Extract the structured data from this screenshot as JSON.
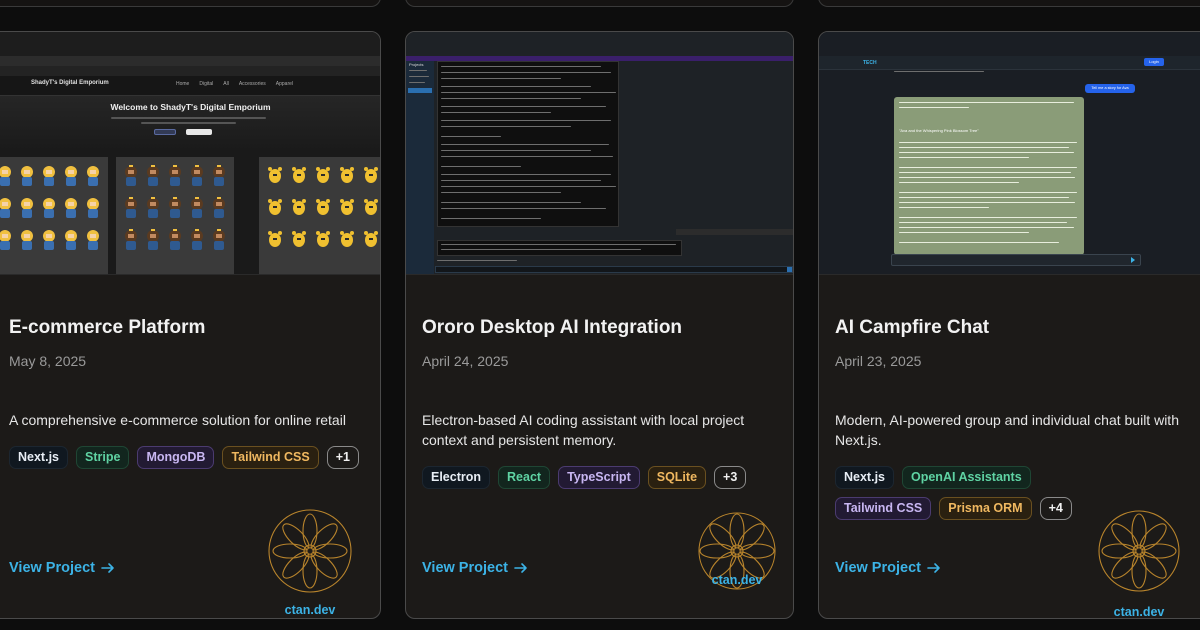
{
  "watermark": {
    "text": "ctan.dev"
  },
  "cards": [
    {
      "title": "E-commerce Platform",
      "date": "May 8, 2025",
      "description": "A comprehensive e-commerce solution for online retail",
      "tags": [
        "Next.js",
        "Stripe",
        "MongoDB",
        "Tailwind CSS"
      ],
      "more": "+1",
      "link": "View Project",
      "screenshot": {
        "brand": "ShadyT's Digital Emporium",
        "heading": "Welcome to ShadyT's Digital Emporium",
        "nav": [
          "Home",
          "Digital",
          "All",
          "Accessories",
          "Apparel"
        ]
      }
    },
    {
      "title": "Ororo Desktop AI Integration",
      "date": "April 24, 2025",
      "description": "Electron-based AI coding assistant with local project context and persistent memory.",
      "tags": [
        "Electron",
        "React",
        "TypeScript",
        "SQLite"
      ],
      "more": "+3",
      "link": "View Project",
      "screenshot": {
        "sidebar_title": "Projects"
      }
    },
    {
      "title": "AI Campfire Chat",
      "date": "April 23, 2025",
      "description": "Modern, AI-powered group and individual chat built with Next.js.",
      "tags": [
        "Next.js",
        "OpenAI Assistants",
        "Tailwind CSS",
        "Prisma ORM"
      ],
      "more": "+4",
      "link": "View Project",
      "screenshot": {
        "brand": "TECH",
        "login": "Login",
        "prompt": "Tell me a story for Ava",
        "story_title": "\"Ava and the Whispering Pink Blossom Tree\""
      }
    }
  ]
}
